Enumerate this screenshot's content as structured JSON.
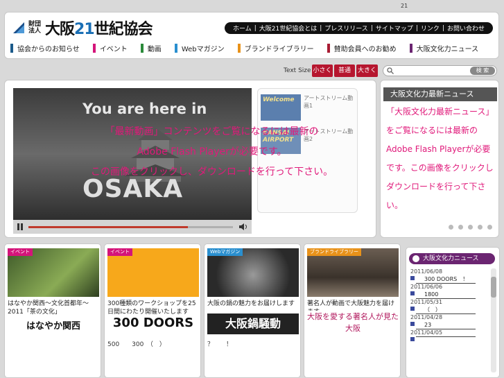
{
  "page_number": "21",
  "header": {
    "logo_small": "財団法人",
    "logo_pre": "大阪",
    "logo_num": "21",
    "logo_post": "世紀協会",
    "topnav": [
      "ホーム",
      "大阪21世紀協会とは",
      "プレスリリース",
      "サイトマップ",
      "リンク",
      "お問い合わせ"
    ],
    "categories": [
      {
        "label": "協会からのお知らせ",
        "color": "#1b5a8a"
      },
      {
        "label": "イベント",
        "color": "#d4147a"
      },
      {
        "label": "動画",
        "color": "#2b8a3a"
      },
      {
        "label": "Webマガジン",
        "color": "#2a8fcf"
      },
      {
        "label": "ブランドライブラリー",
        "color": "#e8921a"
      },
      {
        "label": "賛助会員へのお勧め",
        "color": "#a81c33"
      },
      {
        "label": "大阪文化力ニュース",
        "color": "#6b2571"
      }
    ]
  },
  "toolbar": {
    "text_size_label": "Text Size",
    "small": "小さく",
    "normal": "普通",
    "large": "大きく",
    "search_button": "検 索"
  },
  "video": {
    "title": "You are here in",
    "city": "OSAKA",
    "progress": 0.78,
    "thumbs": [
      {
        "img_text": "Welcome",
        "label": "アートストリーム動画1"
      },
      {
        "img_text": "KANSAI AIRPORT",
        "label": "アートストリーム動画2"
      }
    ],
    "message": [
      "「最新動画」コンテンツをご覧になるには最新の",
      "Adobe Flash Playerが必要です。",
      "この画像をクリックし、ダウンロードを行って下さい。"
    ]
  },
  "news_panel": {
    "head": "大阪文化力最新ニュース",
    "message": "「大阪文化力最新ニュース」をご覧になるには最新のAdobe Flash Playerが必要です。この画像をクリックしダウンロードを行って下さい。"
  },
  "cards": [
    {
      "tag": "イベント",
      "tag_color": "#d4147a",
      "caption": "はなやか関西～文化首都年～2011「茶の文化」",
      "logo": "はなやか関西",
      "foot": ""
    },
    {
      "tag": "イベント",
      "tag_color": "#d4147a",
      "caption": "300種類のワークショップを25日間にわたり開催いたします",
      "logo": "300 DOORS",
      "foot": "500　　300　（　）"
    },
    {
      "tag": "Webマガジン",
      "tag_color": "#2a8fcf",
      "caption": "大阪の鍋の魅力をお届けします",
      "logo": "大阪鍋騒動",
      "foot": "？　　！"
    },
    {
      "tag": "ブランドライブラリー",
      "tag_color": "#e8921a",
      "caption": "著名人が動画で大阪魅力を届けます",
      "logo": "大阪を愛する著名人が見た大阪",
      "foot": ""
    }
  ],
  "right_news": {
    "head": "大阪文化力ニュース",
    "items": [
      {
        "date": "2011/06/08",
        "title": "300 DOORS　！"
      },
      {
        "date": "2011/06/06",
        "title": "1800"
      },
      {
        "date": "2011/05/31",
        "title": "（　）"
      },
      {
        "date": "2011/04/28",
        "title": "23"
      },
      {
        "date": "2011/04/05",
        "title": ""
      }
    ]
  }
}
